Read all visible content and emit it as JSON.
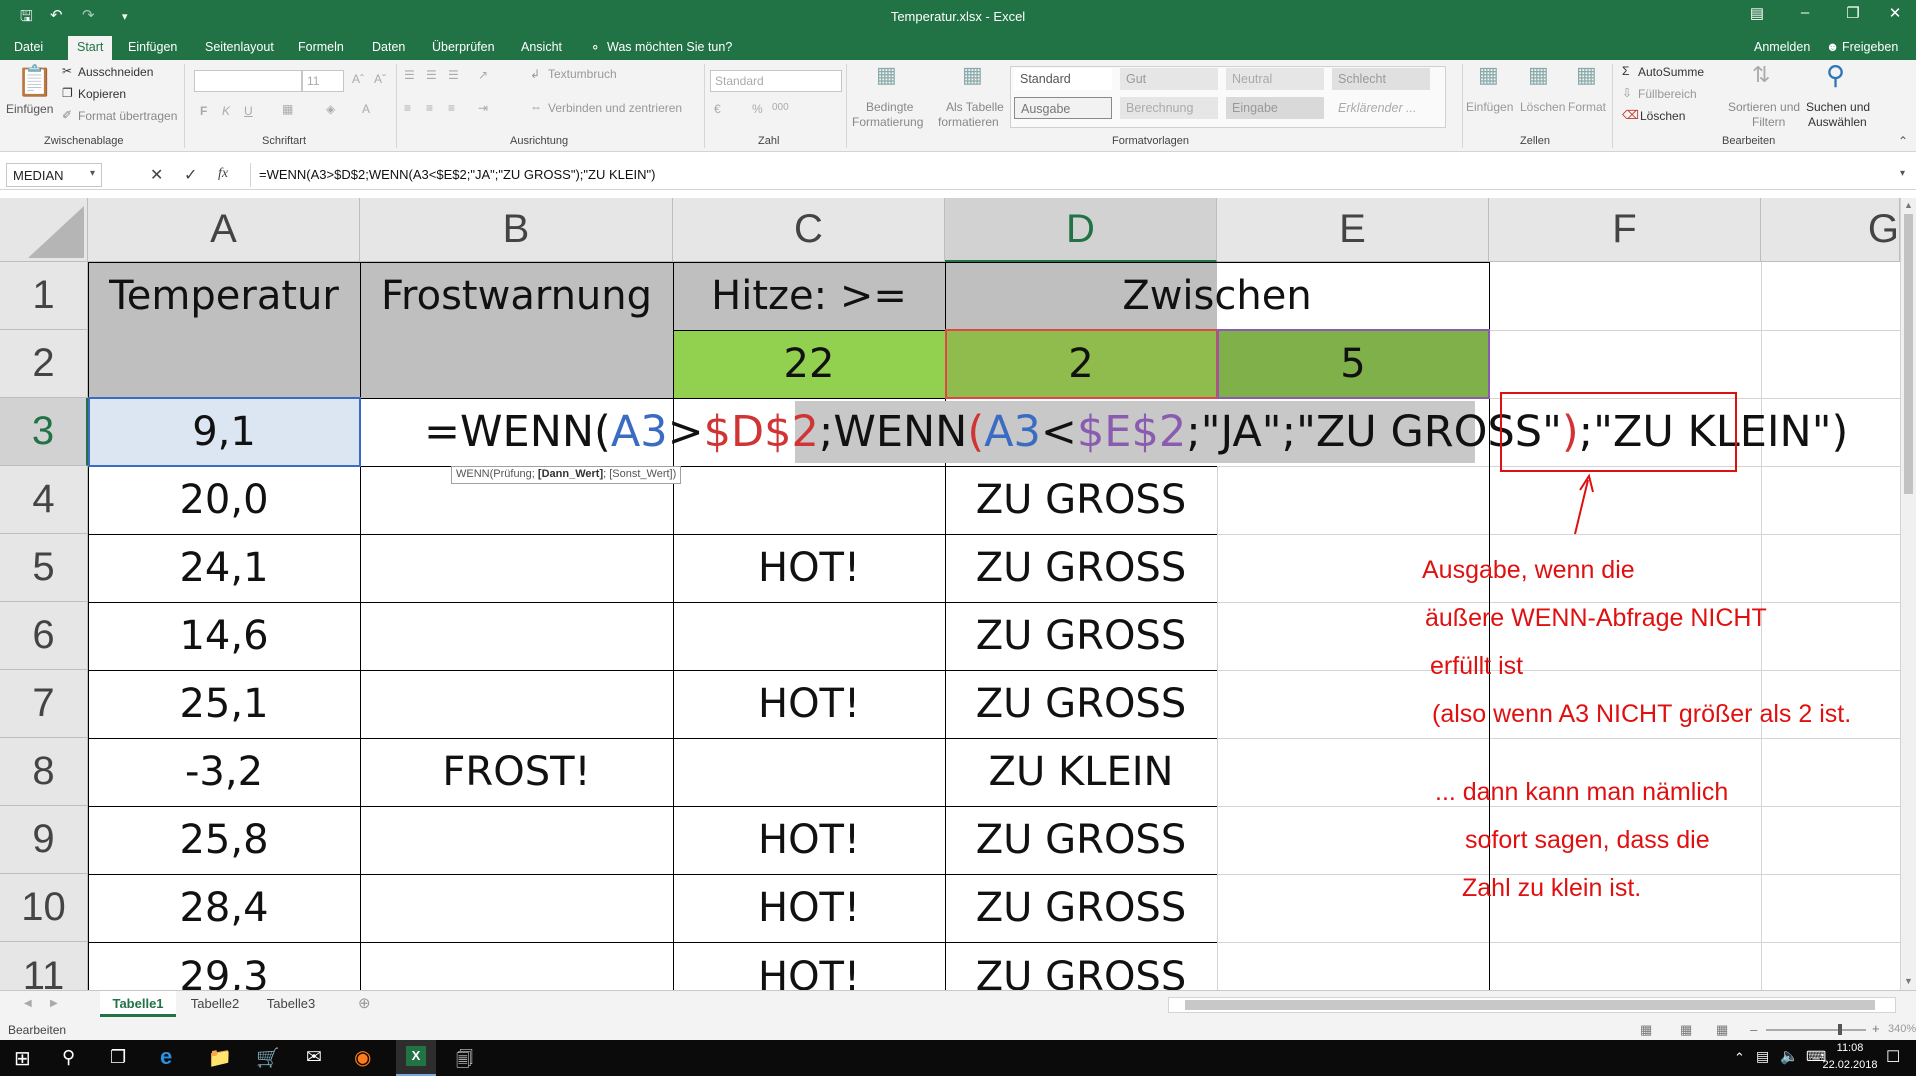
{
  "window": {
    "title": "Temperatur.xlsx - Excel"
  },
  "menu": {
    "tabs": [
      "Datei",
      "Start",
      "Einfügen",
      "Seitenlayout",
      "Formeln",
      "Daten",
      "Überprüfen",
      "Ansicht"
    ],
    "tell_me": "Was möchten Sie tun?",
    "signin": "Anmelden",
    "share": "Freigeben"
  },
  "ribbon": {
    "clipboard": {
      "paste": "Einfügen",
      "cut": "Ausschneiden",
      "copy": "Kopieren",
      "format_painter": "Format übertragen",
      "group": "Zwischenablage"
    },
    "font": {
      "size": "11",
      "group": "Schriftart",
      "bold": "F",
      "italic": "K",
      "underline": "U"
    },
    "alignment": {
      "wrap": "Textumbruch",
      "merge": "Verbinden und zentrieren",
      "group": "Ausrichtung"
    },
    "number": {
      "format": "Standard",
      "group": "Zahl"
    },
    "styles": {
      "conditional_1": "Bedingte",
      "conditional_2": "Formatierung",
      "table_1": "Als Tabelle",
      "table_2": "formatieren",
      "items": [
        "Standard",
        "Gut",
        "Neutral",
        "Schlecht",
        "Ausgabe",
        "Berechnung",
        "Eingabe",
        "Erklärender ..."
      ],
      "group": "Formatvorlagen"
    },
    "cells": {
      "insert": "Einfügen",
      "delete": "Löschen",
      "format": "Format",
      "group": "Zellen"
    },
    "editing": {
      "autosum": "AutoSumme",
      "fill": "Füllbereich",
      "clear": "Löschen",
      "sort_1": "Sortieren und",
      "sort_2": "Filtern",
      "find_1": "Suchen und",
      "find_2": "Auswählen",
      "group": "Bearbeiten"
    }
  },
  "formula_bar": {
    "name_box": "MEDIAN",
    "fx": "fx",
    "formula": "=WENN(A3>$D$2;WENN(A3<$E$2;\"JA\";\"ZU GROSS\");\"ZU KLEIN\")"
  },
  "columns": [
    "A",
    "B",
    "C",
    "D",
    "E",
    "F",
    "G"
  ],
  "rows": [
    "1",
    "2",
    "3",
    "4",
    "5",
    "6",
    "7",
    "8",
    "9",
    "10",
    "11"
  ],
  "cells": {
    "A1": "Temperatur",
    "B1": "Frostwarnung",
    "C1": "Hitze: >=",
    "D1": "Zwischen",
    "C2": "22",
    "D2": "2",
    "E2": "5",
    "A3": "9,1",
    "A4": "20,0",
    "D4": "ZU GROSS",
    "A5": "24,1",
    "C5": "HOT!",
    "D5": "ZU GROSS",
    "A6": "14,6",
    "D6": "ZU GROSS",
    "A7": "25,1",
    "C7": "HOT!",
    "D7": "ZU GROSS",
    "A8": "-3,2",
    "B8": "FROST!",
    "D8": "ZU KLEIN",
    "A9": "25,8",
    "C9": "HOT!",
    "D9": "ZU GROSS",
    "A10": "28,4",
    "C10": "HOT!",
    "D10": "ZU GROSS",
    "A11": "29,3",
    "C11": "HOT!",
    "D11": "ZU GROSS"
  },
  "edit_formula": {
    "p1": "=WENN(",
    "p2": "A3",
    "p3": ">",
    "p4": "$D$2",
    "p5": ";",
    "p6": "WENN",
    "p7": "(",
    "p8": "A3",
    "p9": "<",
    "p10": "$E$2",
    "p11": ";\"JA\";\"ZU GROSS\"",
    "p12": ")",
    "p13": ";",
    "p14": "\"ZU KLEIN\"",
    "p15": ")"
  },
  "tooltip": {
    "a": "WENN(Prüfung; ",
    "b": "[Dann_Wert]",
    "c": "; [Sonst_Wert])"
  },
  "annotation": [
    "Ausgabe, wenn die",
    "äußere WENN-Abfrage NICHT",
    "erfüllt ist",
    "(also wenn A3 NICHT größer als 2 ist.",
    "... dann kann man nämlich",
    "sofort sagen, dass die",
    "Zahl zu klein ist."
  ],
  "sheets": [
    "Tabelle1",
    "Tabelle2",
    "Tabelle3"
  ],
  "status": {
    "mode": "Bearbeiten",
    "zoom": "340%"
  },
  "taskbar": {
    "time": "11:08",
    "date": "22.02.2018"
  },
  "colors": {
    "excel_green": "#217346",
    "header_gray": "#bfbfbf",
    "green_light": "#92d050",
    "green_mid": "#8fbc4c",
    "green_dark": "#7fb04a",
    "annotation": "#e01010"
  }
}
